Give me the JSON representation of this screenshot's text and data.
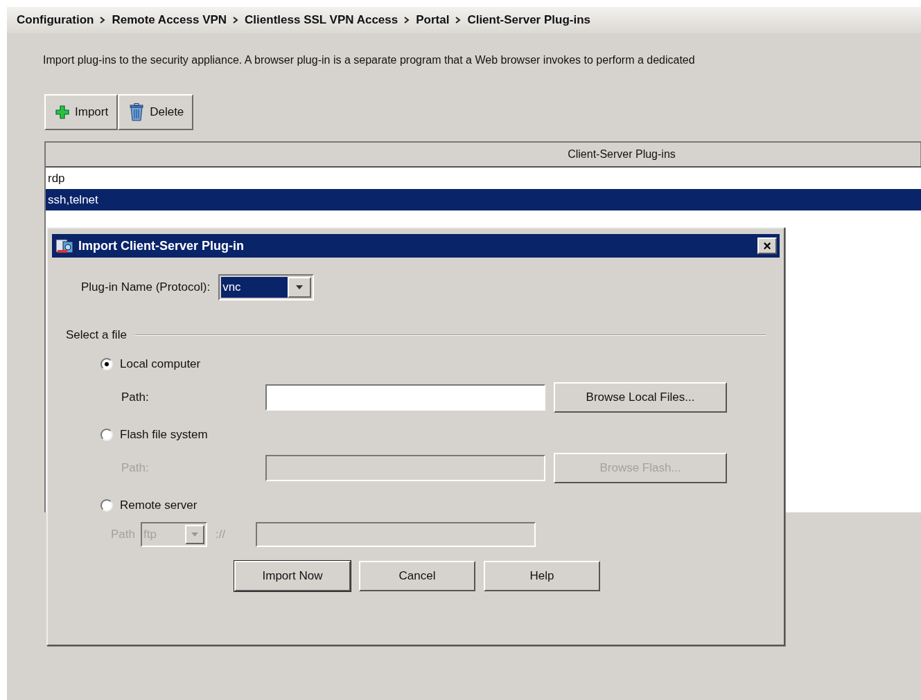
{
  "breadcrumb": [
    "Configuration",
    "Remote Access VPN",
    "Clientless SSL VPN Access",
    "Portal",
    "Client-Server Plug-ins"
  ],
  "description": "Import plug-ins to the security appliance. A browser plug-in is a separate program that a Web browser invokes to perform a dedicated",
  "toolbar": [
    {
      "kind": "add",
      "label": "Import"
    },
    {
      "kind": "delete",
      "label": "Delete"
    }
  ],
  "table": {
    "columns": [
      "Client-Server Plug-ins"
    ],
    "rows": [
      {
        "name": "rdp",
        "selected": false
      },
      {
        "name": "ssh,telnet",
        "selected": true
      }
    ]
  },
  "dialog": {
    "title": "Import Client-Server Plug-in",
    "close": "×",
    "plugin_label": "Plug-in Name (Protocol):",
    "plugin_value": "vnc",
    "group_label": "Select a file",
    "sources": [
      {
        "kind": "local",
        "label": "Local computer",
        "selected": true,
        "path_label": "Path:",
        "disabled": false,
        "browse": "Browse Local Files..."
      },
      {
        "kind": "flash",
        "label": "Flash file system",
        "selected": false,
        "path_label": "Path:",
        "disabled": true,
        "browse": "Browse Flash..."
      },
      {
        "kind": "remote",
        "label": "Remote server",
        "selected": false,
        "path_label": "Path",
        "disabled": true,
        "protocol": "ftp",
        "separator": "://"
      }
    ],
    "buttons": [
      "Import Now",
      "Cancel",
      "Help"
    ]
  }
}
